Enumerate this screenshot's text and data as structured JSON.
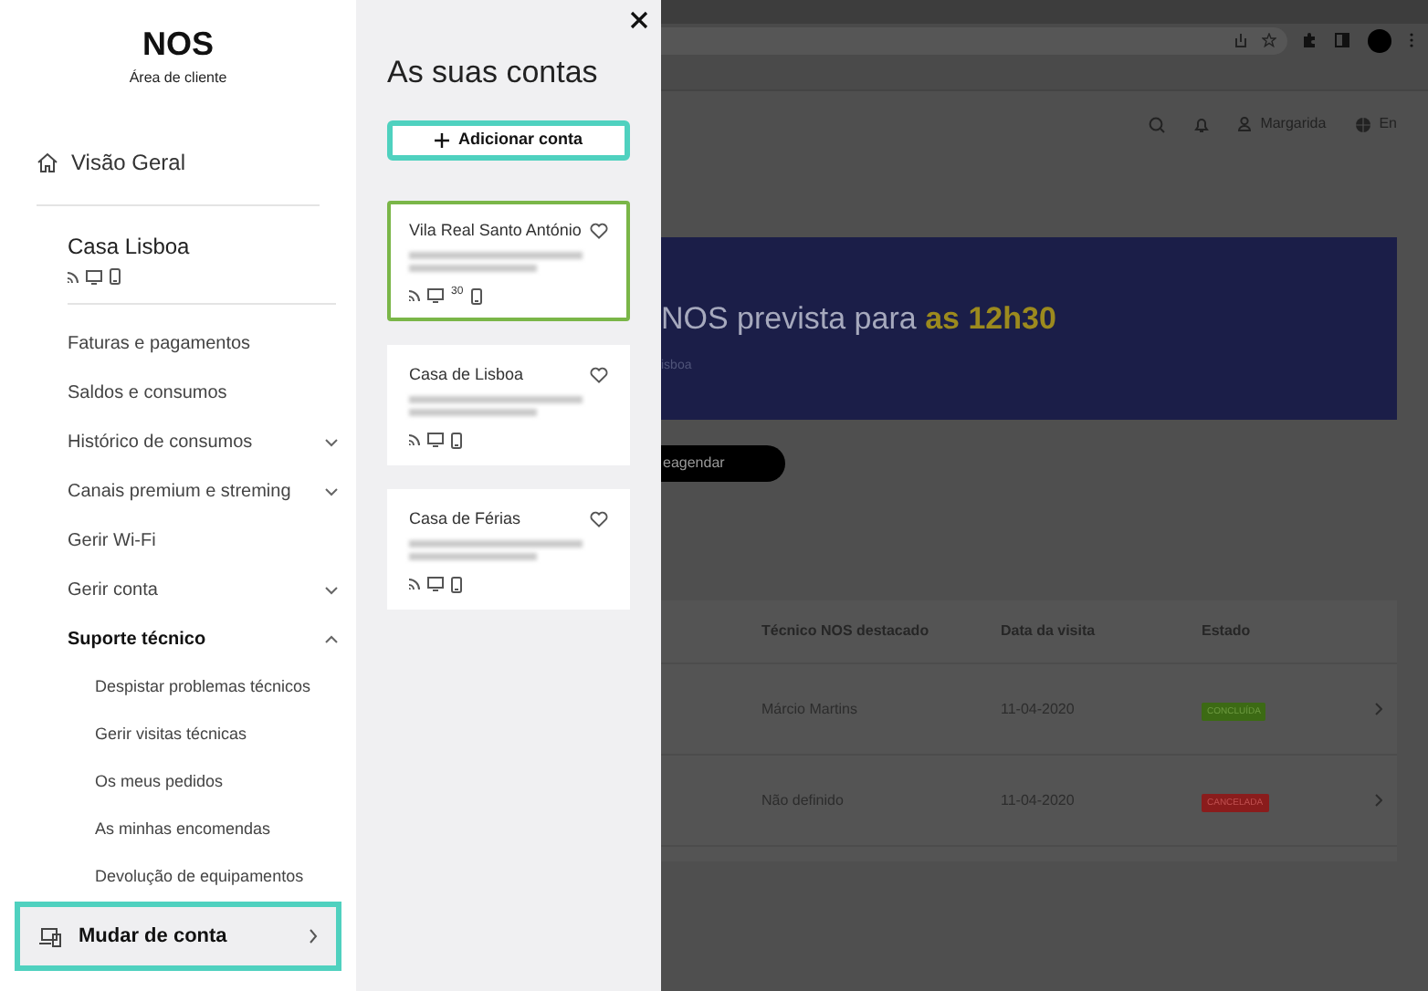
{
  "sidebar": {
    "logo": {
      "brand": "NOS",
      "subtitle": "Área de cliente"
    },
    "overview": "Visão Geral",
    "account": {
      "name": "Casa Lisboa"
    },
    "items": [
      {
        "label": "Faturas e pagamentos"
      },
      {
        "label": "Saldos e consumos"
      },
      {
        "label": "Histórico de consumos",
        "expanded": false
      },
      {
        "label": "Canais premium e streming",
        "expanded": false
      },
      {
        "label": "Gerir Wi-Fi"
      },
      {
        "label": "Gerir conta",
        "expanded": false
      },
      {
        "label": "Suporte técnico",
        "expanded": true,
        "children": [
          {
            "label": "Despistar problemas técnicos"
          },
          {
            "label": "Gerir visitas técnicas"
          },
          {
            "label": "Os meus pedidos"
          },
          {
            "label": "As minhas encomendas"
          },
          {
            "label": "Devolução de equipamentos"
          }
        ]
      }
    ],
    "switch_account": "Mudar de conta"
  },
  "accounts_panel": {
    "title": "As suas contas",
    "add_button": "Adicionar conta",
    "accounts": [
      {
        "name": "Vila Real Santo António",
        "selected": true,
        "tv_badge": "30"
      },
      {
        "name": "Casa de Lisboa",
        "selected": false
      },
      {
        "name": "Casa de Férias",
        "selected": false
      }
    ]
  },
  "background_page": {
    "user": "Margarida",
    "language": "En",
    "banner": {
      "title": "NOS prevista para **as 12h30**",
      "subtitle": "isboa",
      "button": "eagendar"
    },
    "table": {
      "columns": [
        "Técnico NOS destacado",
        "Data da visita",
        "Estado"
      ],
      "rows": [
        {
          "technician": "Márcio Martins",
          "date": "11-04-2020",
          "status": "CONCLUÍDA",
          "kind": "done"
        },
        {
          "technician": "Não definido",
          "date": "11-04-2020",
          "status": "CANCELADA",
          "kind": "cancelled"
        }
      ]
    }
  }
}
